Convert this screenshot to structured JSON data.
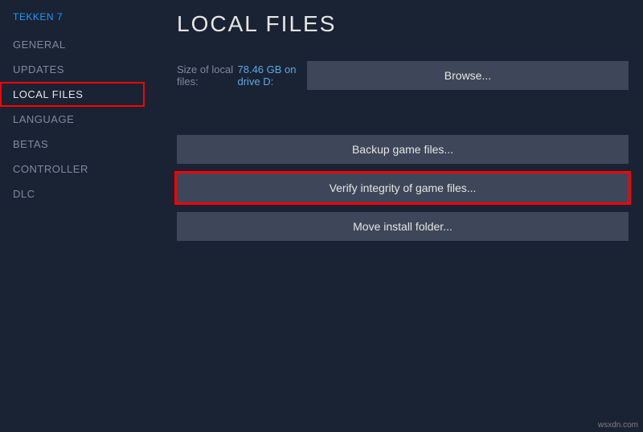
{
  "game_title": "TEKKEN 7",
  "sidebar": {
    "items": [
      {
        "label": "GENERAL",
        "name": "sidebar-item-general",
        "active": false,
        "highlight": false
      },
      {
        "label": "UPDATES",
        "name": "sidebar-item-updates",
        "active": false,
        "highlight": false
      },
      {
        "label": "LOCAL FILES",
        "name": "sidebar-item-local-files",
        "active": true,
        "highlight": true
      },
      {
        "label": "LANGUAGE",
        "name": "sidebar-item-language",
        "active": false,
        "highlight": false
      },
      {
        "label": "BETAS",
        "name": "sidebar-item-betas",
        "active": false,
        "highlight": false
      },
      {
        "label": "CONTROLLER",
        "name": "sidebar-item-controller",
        "active": false,
        "highlight": false
      },
      {
        "label": "DLC",
        "name": "sidebar-item-dlc",
        "active": false,
        "highlight": false
      }
    ]
  },
  "main": {
    "title": "LOCAL FILES",
    "size_label": "Size of local files:",
    "size_value": "78.46 GB on drive D:",
    "browse_label": "Browse...",
    "buttons": [
      {
        "label": "Backup game files...",
        "name": "backup-game-files-button",
        "highlight": false
      },
      {
        "label": "Verify integrity of game files...",
        "name": "verify-integrity-button",
        "highlight": true
      },
      {
        "label": "Move install folder...",
        "name": "move-install-folder-button",
        "highlight": false
      }
    ]
  },
  "watermark": "wsxdn.com"
}
